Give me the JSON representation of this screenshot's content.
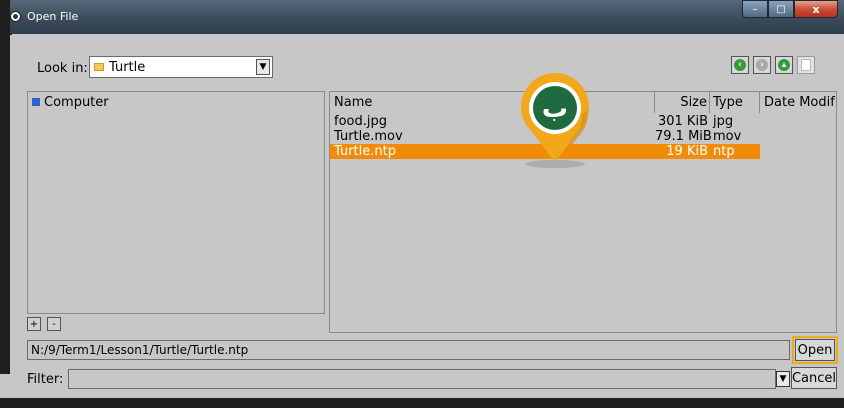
{
  "window": {
    "title": "Open File"
  },
  "titlebar_buttons": {
    "minimize": "–",
    "maximize": "□",
    "close": "x"
  },
  "look_in": {
    "label": "Look in:",
    "value": "Turtle"
  },
  "nav_icons": [
    "back-icon",
    "forward-icon",
    "up-icon",
    "new-folder-icon"
  ],
  "places": {
    "items": [
      {
        "label": "Computer",
        "icon": "computer-icon"
      }
    ],
    "add_label": "+",
    "remove_label": "-"
  },
  "file_list": {
    "columns": [
      "Name",
      "Size",
      "Type",
      "Date Modif"
    ],
    "rows": [
      {
        "name": "food.jpg",
        "size": "301 KiB",
        "type": "jpg",
        "selected": false
      },
      {
        "name": "Turtle.mov",
        "size": "79.1 MiB",
        "type": "mov",
        "selected": false
      },
      {
        "name": "Turtle.ntp",
        "size": "19 KiB",
        "type": "ntp",
        "selected": true
      }
    ]
  },
  "path": {
    "value": "N:/9/Term1/Lesson1/Turtle/Turtle.ntp"
  },
  "buttons": {
    "open": "Open",
    "cancel": "Cancel"
  },
  "filter": {
    "label": "Filter:",
    "value": ""
  },
  "marker": {
    "glyph": "ب"
  },
  "colors": {
    "selection": "#f28c07",
    "marker_orange": "#f2a81b",
    "marker_green": "#1f6b3f"
  }
}
